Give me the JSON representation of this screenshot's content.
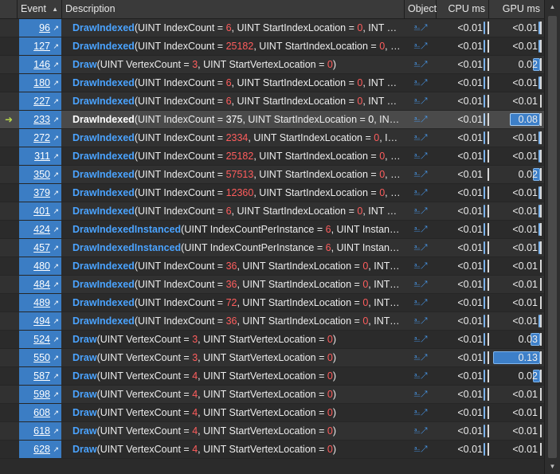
{
  "header": {
    "event": "Event",
    "sort_icon": "sort-ascending-icon",
    "description": "Description",
    "object": "Object",
    "cpu": "CPU ms",
    "gpu": "GPU ms"
  },
  "icons": {
    "jump": "jump-to-event-icon",
    "object_link": "object-link-icon",
    "current_marker": "current-event-arrow-icon"
  },
  "colors": {
    "event_cell": "#3b7dc4",
    "function_name": "#4aa3ff",
    "argument_value": "#ff5d5d",
    "bar": "#3d7fc8",
    "current_row": "#4a4a4a",
    "current_marker": "#b8d64a"
  },
  "rows": [
    {
      "event": "96",
      "fn": "DrawIndexed",
      "parts": [
        {
          "t": "(UINT IndexCount = "
        },
        {
          "v": "6"
        },
        {
          "t": ", UINT StartIndexLocation = "
        },
        {
          "v": "0"
        },
        {
          "t": ", INT BaseV..."
        }
      ],
      "cpu": "<0.01",
      "gpu": "<0.01",
      "cpu_level": 0.01,
      "gpu_level": 0.02
    },
    {
      "event": "127",
      "fn": "DrawIndexed",
      "parts": [
        {
          "t": "(UINT IndexCount = "
        },
        {
          "v": "25182"
        },
        {
          "t": ", UINT StartIndexLocation = "
        },
        {
          "v": "0"
        },
        {
          "t": ", INT B..."
        }
      ],
      "cpu": "<0.01",
      "gpu": "<0.01",
      "cpu_level": 0.01,
      "gpu_level": 0.02
    },
    {
      "event": "146",
      "fn": "Draw",
      "parts": [
        {
          "t": "(UINT VertexCount = "
        },
        {
          "v": "3"
        },
        {
          "t": ", UINT StartVertexLocation = "
        },
        {
          "v": "0"
        },
        {
          "t": ")"
        }
      ],
      "cpu": "<0.01",
      "gpu": "0.02",
      "cpu_level": 0.01,
      "gpu_level": 0.14
    },
    {
      "event": "180",
      "fn": "DrawIndexed",
      "parts": [
        {
          "t": "(UINT IndexCount = "
        },
        {
          "v": "6"
        },
        {
          "t": ", UINT StartIndexLocation = "
        },
        {
          "v": "0"
        },
        {
          "t": ", INT BaseV..."
        }
      ],
      "cpu": "<0.01",
      "gpu": "<0.01",
      "cpu_level": 0.01,
      "gpu_level": 0.02
    },
    {
      "event": "227",
      "fn": "DrawIndexed",
      "parts": [
        {
          "t": "(UINT IndexCount = "
        },
        {
          "v": "6"
        },
        {
          "t": ", UINT StartIndexLocation = "
        },
        {
          "v": "0"
        },
        {
          "t": ", INT BaseV..."
        }
      ],
      "cpu": "<0.01",
      "gpu": "<0.01",
      "cpu_level": 0.01,
      "gpu_level": 0.0
    },
    {
      "event": "233",
      "current": true,
      "fn": "DrawIndexed",
      "parts": [
        {
          "t": "(UINT IndexCount = "
        },
        {
          "v": "375"
        },
        {
          "t": ", UINT StartIndexLocation = "
        },
        {
          "v": "0"
        },
        {
          "t": ", INT Bas..."
        }
      ],
      "cpu": "<0.01",
      "gpu": "0.08",
      "cpu_level": 0.01,
      "gpu_level": 0.62
    },
    {
      "event": "272",
      "fn": "DrawIndexed",
      "parts": [
        {
          "t": "(UINT IndexCount = "
        },
        {
          "v": "2334"
        },
        {
          "t": ", UINT StartIndexLocation = "
        },
        {
          "v": "0"
        },
        {
          "t": ", INT Ba..."
        }
      ],
      "cpu": "<0.01",
      "gpu": "<0.01",
      "cpu_level": 0.01,
      "gpu_level": 0.02
    },
    {
      "event": "311",
      "fn": "DrawIndexed",
      "parts": [
        {
          "t": "(UINT IndexCount = "
        },
        {
          "v": "25182"
        },
        {
          "t": ", UINT StartIndexLocation = "
        },
        {
          "v": "0"
        },
        {
          "t": ", INT B..."
        }
      ],
      "cpu": "<0.01",
      "gpu": "<0.01",
      "cpu_level": 0.01,
      "gpu_level": 0.02
    },
    {
      "event": "350",
      "fn": "DrawIndexed",
      "parts": [
        {
          "t": "(UINT IndexCount = "
        },
        {
          "v": "57513"
        },
        {
          "t": ", UINT StartIndexLocation = "
        },
        {
          "v": "0"
        },
        {
          "t": ", INT B..."
        }
      ],
      "cpu": "<0.01",
      "gpu": "0.02",
      "cpu_level": 0.0,
      "gpu_level": 0.14
    },
    {
      "event": "379",
      "fn": "DrawIndexed",
      "parts": [
        {
          "t": "(UINT IndexCount = "
        },
        {
          "v": "12360"
        },
        {
          "t": ", UINT StartIndexLocation = "
        },
        {
          "v": "0"
        },
        {
          "t": ", INT B..."
        }
      ],
      "cpu": "<0.01",
      "gpu": "<0.01",
      "cpu_level": 0.01,
      "gpu_level": 0.02
    },
    {
      "event": "401",
      "fn": "DrawIndexed",
      "parts": [
        {
          "t": "(UINT IndexCount = "
        },
        {
          "v": "6"
        },
        {
          "t": ", UINT StartIndexLocation = "
        },
        {
          "v": "0"
        },
        {
          "t": ", INT BaseV..."
        }
      ],
      "cpu": "<0.01",
      "gpu": "<0.01",
      "cpu_level": 0.01,
      "gpu_level": 0.02
    },
    {
      "event": "424",
      "fn": "DrawIndexedInstanced",
      "parts": [
        {
          "t": "(UINT IndexCountPerInstance = "
        },
        {
          "v": "6"
        },
        {
          "t": ", UINT InstanceCou..."
        }
      ],
      "cpu": "<0.01",
      "gpu": "<0.01",
      "cpu_level": 0.03,
      "gpu_level": 0.02
    },
    {
      "event": "457",
      "fn": "DrawIndexedInstanced",
      "parts": [
        {
          "t": "(UINT IndexCountPerInstance = "
        },
        {
          "v": "6"
        },
        {
          "t": ", UINT InstanceCou..."
        }
      ],
      "cpu": "<0.01",
      "gpu": "<0.01",
      "cpu_level": 0.01,
      "gpu_level": 0.02
    },
    {
      "event": "480",
      "fn": "DrawIndexed",
      "parts": [
        {
          "t": "(UINT IndexCount = "
        },
        {
          "v": "36"
        },
        {
          "t": ", UINT StartIndexLocation = "
        },
        {
          "v": "0"
        },
        {
          "t": ", INT Base..."
        }
      ],
      "cpu": "<0.01",
      "gpu": "<0.01",
      "cpu_level": 0.01,
      "gpu_level": 0.0
    },
    {
      "event": "484",
      "fn": "DrawIndexed",
      "parts": [
        {
          "t": "(UINT IndexCount = "
        },
        {
          "v": "36"
        },
        {
          "t": ", UINT StartIndexLocation = "
        },
        {
          "v": "0"
        },
        {
          "t": ", INT Base..."
        }
      ],
      "cpu": "<0.01",
      "gpu": "<0.01",
      "cpu_level": 0.01,
      "gpu_level": 0.0
    },
    {
      "event": "489",
      "fn": "DrawIndexed",
      "parts": [
        {
          "t": "(UINT IndexCount = "
        },
        {
          "v": "72"
        },
        {
          "t": ", UINT StartIndexLocation = "
        },
        {
          "v": "0"
        },
        {
          "t": ", INT Base..."
        }
      ],
      "cpu": "<0.01",
      "gpu": "<0.01",
      "cpu_level": 0.01,
      "gpu_level": 0.0
    },
    {
      "event": "494",
      "fn": "DrawIndexed",
      "parts": [
        {
          "t": "(UINT IndexCount = "
        },
        {
          "v": "36"
        },
        {
          "t": ", UINT StartIndexLocation = "
        },
        {
          "v": "0"
        },
        {
          "t": ", INT Base..."
        }
      ],
      "cpu": "<0.01",
      "gpu": "<0.01",
      "cpu_level": 0.01,
      "gpu_level": 0.02
    },
    {
      "event": "524",
      "fn": "Draw",
      "parts": [
        {
          "t": "(UINT VertexCount = "
        },
        {
          "v": "3"
        },
        {
          "t": ", UINT StartVertexLocation = "
        },
        {
          "v": "0"
        },
        {
          "t": ")"
        }
      ],
      "cpu": "<0.01",
      "gpu": "0.03",
      "cpu_level": 0.01,
      "gpu_level": 0.2
    },
    {
      "event": "550",
      "fn": "Draw",
      "parts": [
        {
          "t": "(UINT VertexCount = "
        },
        {
          "v": "3"
        },
        {
          "t": ", UINT StartVertexLocation = "
        },
        {
          "v": "0"
        },
        {
          "t": ")"
        }
      ],
      "cpu": "<0.01",
      "gpu": "0.13",
      "cpu_level": 0.01,
      "gpu_level": 0.96
    },
    {
      "event": "587",
      "fn": "Draw",
      "parts": [
        {
          "t": "(UINT VertexCount = "
        },
        {
          "v": "4"
        },
        {
          "t": ", UINT StartVertexLocation = "
        },
        {
          "v": "0"
        },
        {
          "t": ")"
        }
      ],
      "cpu": "<0.01",
      "gpu": "0.02",
      "cpu_level": 0.01,
      "gpu_level": 0.14
    },
    {
      "event": "598",
      "fn": "Draw",
      "parts": [
        {
          "t": "(UINT VertexCount = "
        },
        {
          "v": "4"
        },
        {
          "t": ", UINT StartVertexLocation = "
        },
        {
          "v": "0"
        },
        {
          "t": ")"
        }
      ],
      "cpu": "<0.01",
      "gpu": "<0.01",
      "cpu_level": 0.01,
      "gpu_level": 0.0
    },
    {
      "event": "608",
      "fn": "Draw",
      "parts": [
        {
          "t": "(UINT VertexCount = "
        },
        {
          "v": "4"
        },
        {
          "t": ", UINT StartVertexLocation = "
        },
        {
          "v": "0"
        },
        {
          "t": ")"
        }
      ],
      "cpu": "<0.01",
      "gpu": "<0.01",
      "cpu_level": 0.01,
      "gpu_level": 0.0
    },
    {
      "event": "618",
      "fn": "Draw",
      "parts": [
        {
          "t": "(UINT VertexCount = "
        },
        {
          "v": "4"
        },
        {
          "t": ", UINT StartVertexLocation = "
        },
        {
          "v": "0"
        },
        {
          "t": ")"
        }
      ],
      "cpu": "<0.01",
      "gpu": "<0.01",
      "cpu_level": 0.01,
      "gpu_level": 0.0
    },
    {
      "event": "628",
      "fn": "Draw",
      "parts": [
        {
          "t": "(UINT VertexCount = "
        },
        {
          "v": "4"
        },
        {
          "t": ", UINT StartVertexLocation = "
        },
        {
          "v": "0"
        },
        {
          "t": ")"
        }
      ],
      "cpu": "<0.01",
      "gpu": "<0.01",
      "cpu_level": 0.01,
      "gpu_level": 0.0
    }
  ]
}
